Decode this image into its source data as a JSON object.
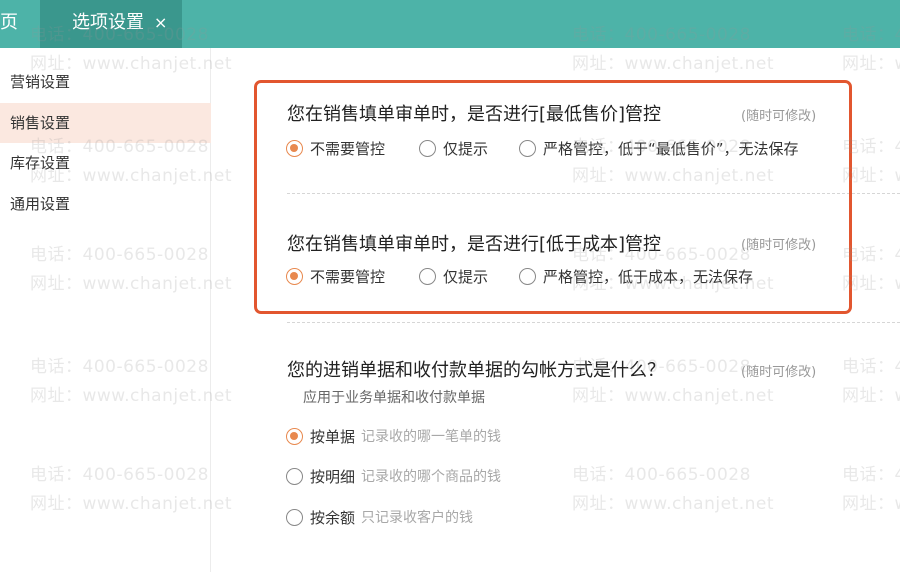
{
  "tabs": {
    "home_label": "页",
    "active_label": "选项设置",
    "close_glyph": "×"
  },
  "sidebar": {
    "items": [
      {
        "label": "营销设置",
        "selected": false
      },
      {
        "label": "销售设置",
        "selected": true
      },
      {
        "label": "库存设置",
        "selected": false
      },
      {
        "label": "通用设置",
        "selected": false
      }
    ]
  },
  "questions": [
    {
      "title": "您在销售填单审单时，是否进行[最低售价]管控",
      "hint": "(随时可修改)",
      "options": [
        {
          "label": "不需要管控",
          "selected": true
        },
        {
          "label": "仅提示",
          "selected": false
        },
        {
          "label": "严格管控，低于“最低售价”，无法保存",
          "selected": false
        }
      ]
    },
    {
      "title": "您在销售填单审单时，是否进行[低于成本]管控",
      "hint": "(随时可修改)",
      "options": [
        {
          "label": "不需要管控",
          "selected": true
        },
        {
          "label": "仅提示",
          "selected": false
        },
        {
          "label": "严格管控，低于成本，无法保存",
          "selected": false
        }
      ]
    },
    {
      "title": "您的进销单据和收付款单据的勾帐方式是什么？",
      "hint": "(随时可修改)",
      "subtitle": "应用于业务单据和收付款单据",
      "options": [
        {
          "label": "按单据",
          "desc": "记录收的哪一笔单的钱",
          "selected": true
        },
        {
          "label": "按明细",
          "desc": "记录收的哪个商品的钱",
          "selected": false
        },
        {
          "label": "按余额",
          "desc": "只记录收客户的钱",
          "selected": false
        }
      ]
    }
  ],
  "watermark": {
    "phone": "电话：400-665-0028",
    "site": "网址：www.chanjet.net"
  },
  "colors": {
    "tabbar": "#4db3a8",
    "tab_active": "#3a978d",
    "highlight_border": "#e2562f",
    "radio_selected": "#e8894f",
    "sidebar_selected": "#fbe8e0"
  }
}
